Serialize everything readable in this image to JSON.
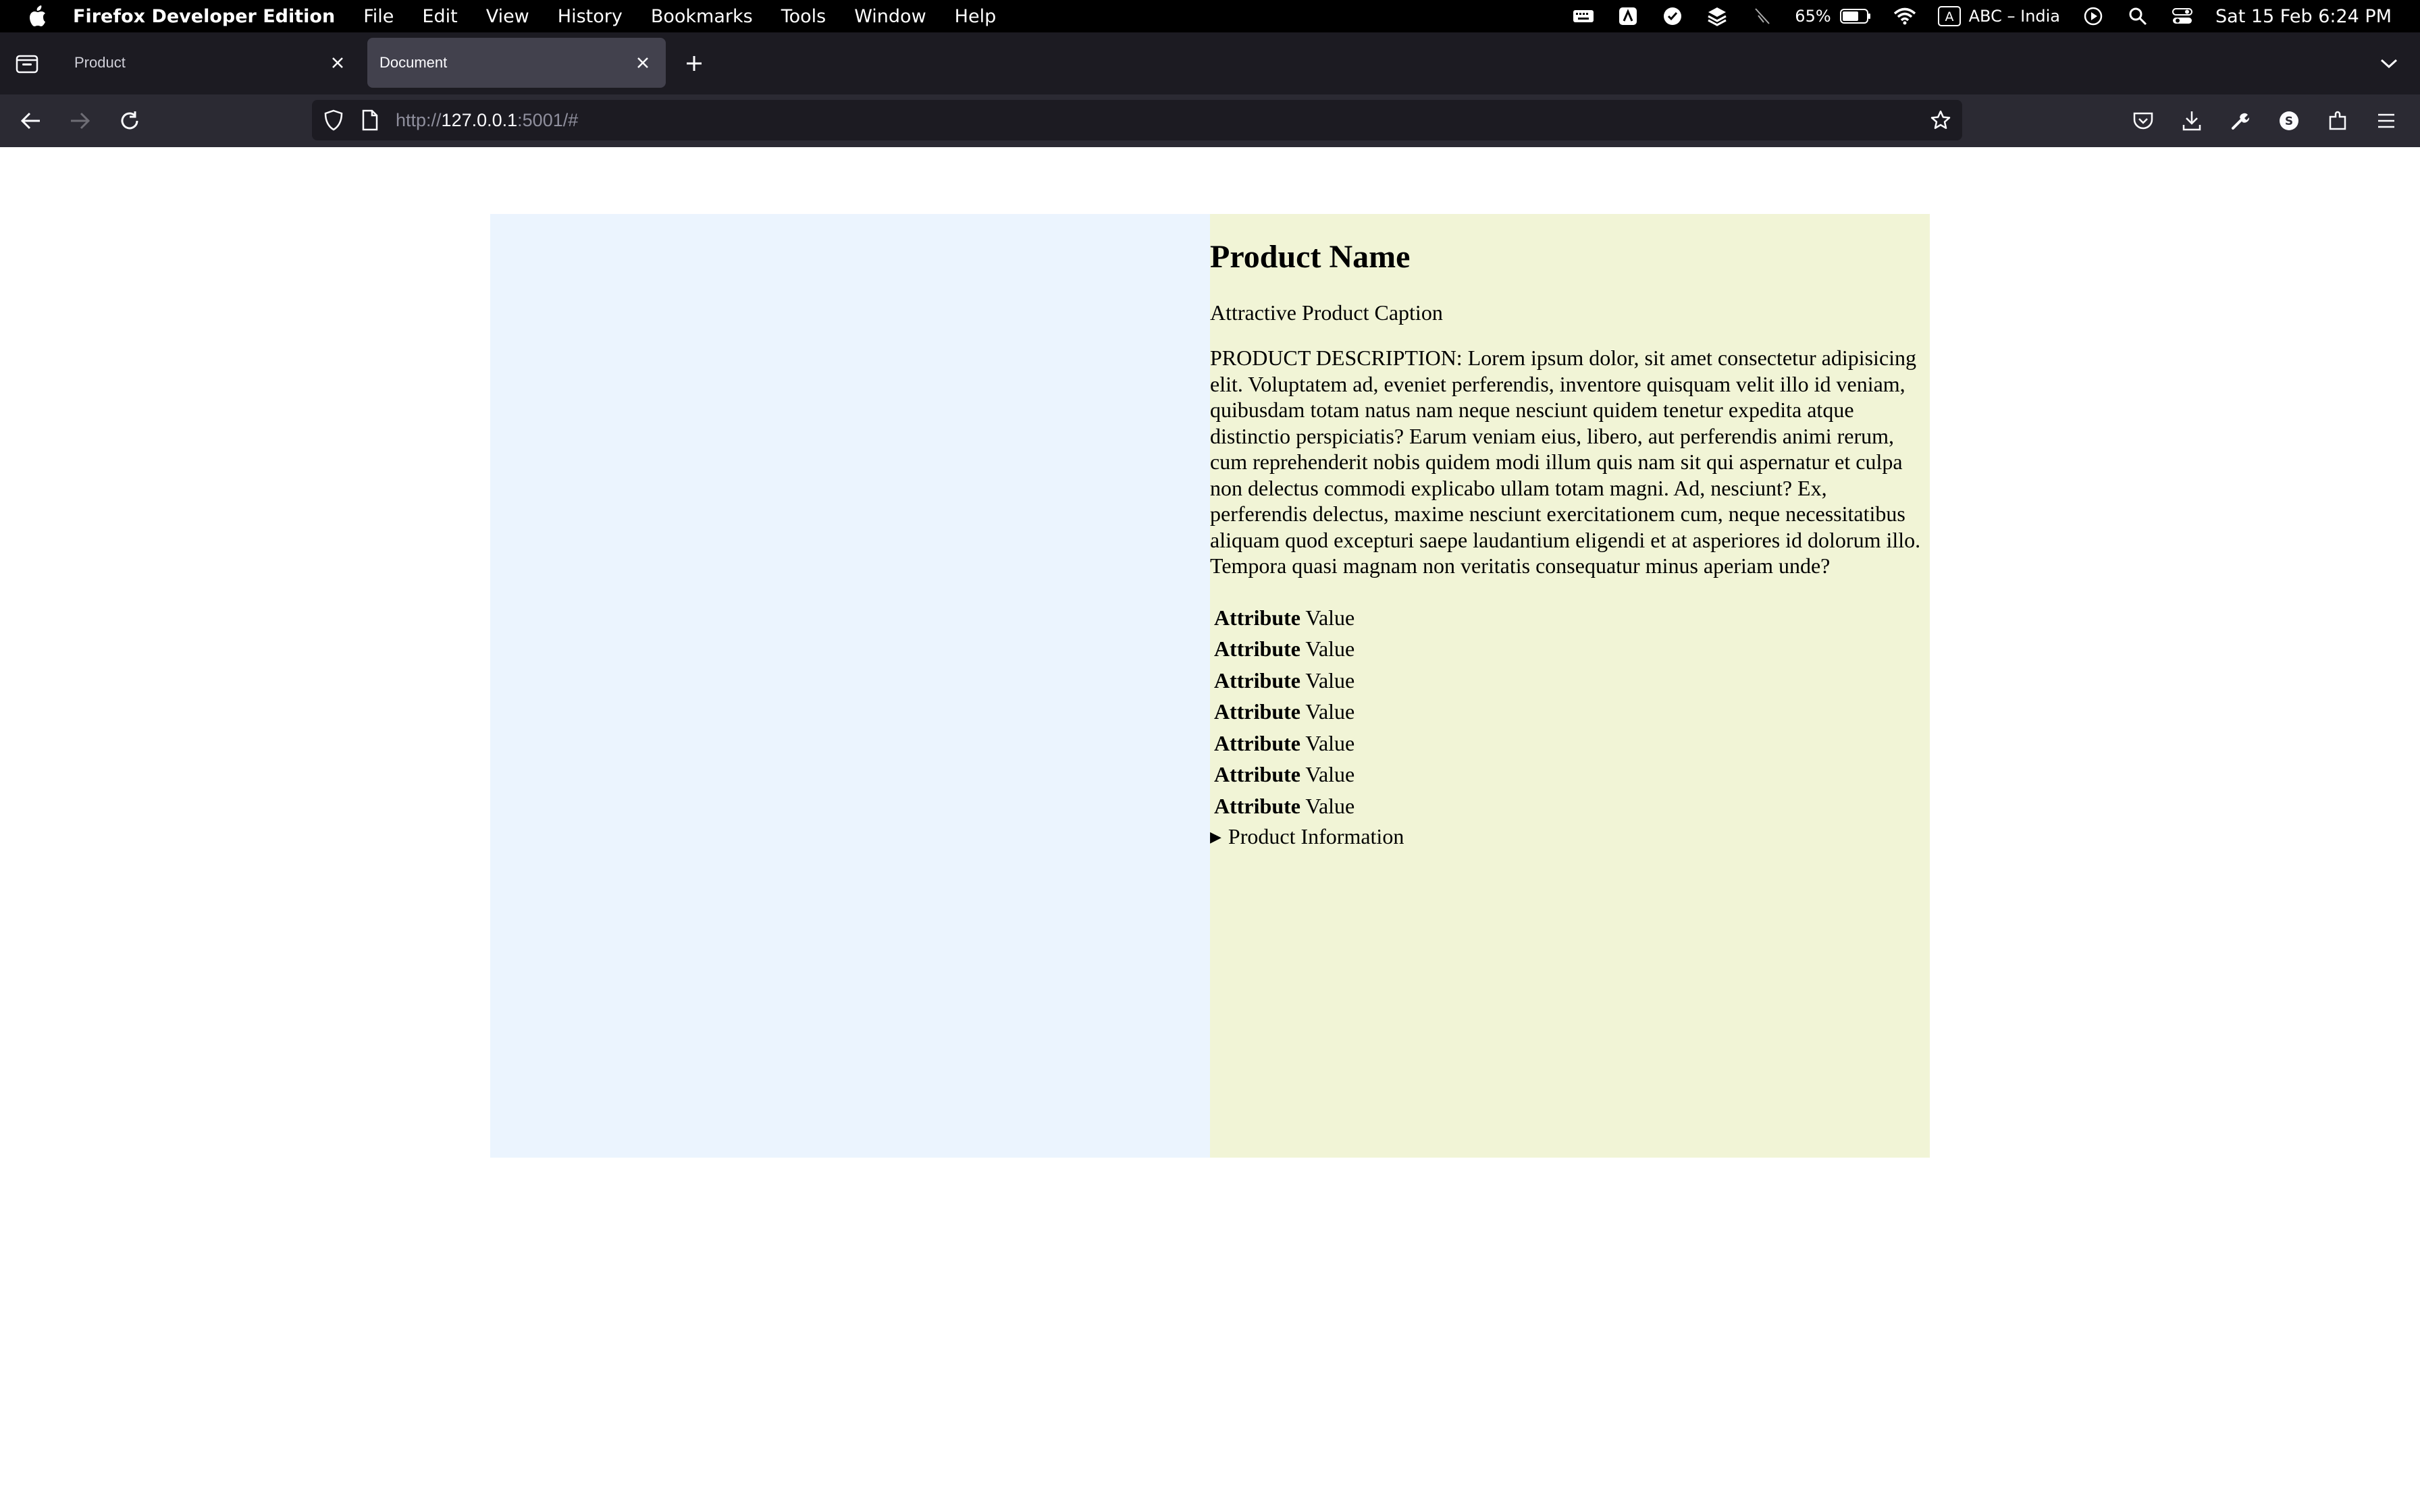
{
  "menubar": {
    "app_name": "Firefox Developer Edition",
    "items": [
      "File",
      "Edit",
      "View",
      "History",
      "Bookmarks",
      "Tools",
      "Window",
      "Help"
    ],
    "battery_percent": "65%",
    "input_source_badge": "A",
    "input_source": "ABC – India",
    "clock": "Sat 15 Feb  6:24 PM"
  },
  "tabs": [
    {
      "title": "Product",
      "active": false
    },
    {
      "title": "Document",
      "active": true
    }
  ],
  "navbar": {
    "url_prefix": "http://",
    "url_host": "127.0.0.1",
    "url_suffix": ":5001/#"
  },
  "product": {
    "name": "Product Name",
    "caption": "Attractive Product Caption",
    "description": "PRODUCT DESCRIPTION: Lorem ipsum dolor, sit amet consectetur adipisicing elit. Voluptatem ad, eveniet perferendis, inventore quisquam velit illo id veniam, quibusdam totam natus nam neque nesciunt quidem tenetur expedita atque distinctio perspiciatis? Earum veniam eius, libero, aut perferendis animi rerum, cum reprehenderit nobis quidem modi illum quis nam sit qui aspernatur et culpa non delectus commodi explicabo ullam totam magni. Ad, nesciunt? Ex, perferendis delectus, maxime nesciunt exercitationem cum, neque necessitatibus aliquam quod excepturi saepe laudantium eligendi et at asperiores id dolorum illo. Tempora quasi magnam non veritatis consequatur minus aperiam unde?",
    "attributes": [
      {
        "name": "Attribute",
        "value": "Value"
      },
      {
        "name": "Attribute",
        "value": "Value"
      },
      {
        "name": "Attribute",
        "value": "Value"
      },
      {
        "name": "Attribute",
        "value": "Value"
      },
      {
        "name": "Attribute",
        "value": "Value"
      },
      {
        "name": "Attribute",
        "value": "Value"
      },
      {
        "name": "Attribute",
        "value": "Value"
      }
    ],
    "details_marker": "▶",
    "details_summary": "Product Information"
  },
  "colors": {
    "image_panel_bg": "#ebf4fe",
    "info_panel_bg": "#f1f4d6",
    "menubar_bg": "#000000",
    "tabstrip_bg": "#1c1b22",
    "navbar_bg": "#2b2a33",
    "active_tab_bg": "#42414d"
  }
}
